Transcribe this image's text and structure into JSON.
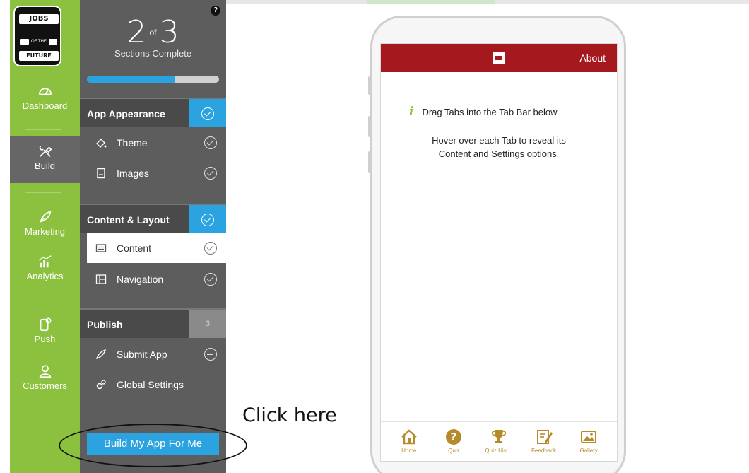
{
  "brand": {
    "logo_top": "JOBS",
    "logo_mid_small": "OF THE",
    "logo_bottom": "FUTURE",
    "accent": "#8cc13f",
    "blue": "#2aa3e0",
    "red": "#a4181e"
  },
  "nav": {
    "items": [
      {
        "label": "Dashboard",
        "icon": "dashboard-gauge-icon"
      },
      {
        "label": "Build",
        "icon": "build-tools-icon"
      },
      {
        "label": "Marketing",
        "icon": "rocket-icon"
      },
      {
        "label": "Analytics",
        "icon": "analytics-chart-icon"
      },
      {
        "label": "Push",
        "icon": "push-phone-icon"
      },
      {
        "label": "Customers",
        "icon": "customers-user-icon"
      }
    ]
  },
  "progress": {
    "completed": "2",
    "of": "of",
    "total": "3",
    "label": "Sections Complete",
    "fraction": 0.67
  },
  "sections": [
    {
      "title": "App Appearance",
      "badge": "check",
      "items": [
        {
          "label": "Theme",
          "icon": "paint-bucket-icon",
          "status": "check"
        },
        {
          "label": "Images",
          "icon": "image-file-icon",
          "status": "check"
        }
      ]
    },
    {
      "title": "Content & Layout",
      "badge": "check",
      "items": [
        {
          "label": "Content",
          "icon": "content-list-icon",
          "status": "check"
        },
        {
          "label": "Navigation",
          "icon": "navigation-layout-icon",
          "status": "check"
        }
      ]
    },
    {
      "title": "Publish",
      "badge": "3",
      "items": [
        {
          "label": "Submit App",
          "icon": "rocket-icon",
          "status": "minus"
        },
        {
          "label": "Global Settings",
          "icon": "gears-icon",
          "status": ""
        }
      ]
    }
  ],
  "build_button": "Build My App For Me",
  "annotation": "Click here",
  "phone": {
    "header_link": "About",
    "info_text": "Drag Tabs into the Tab Bar below.",
    "hint_line1": "Hover over each Tab to reveal its",
    "hint_line2": "Content and Settings options.",
    "tabs": [
      {
        "label": "Home",
        "icon": "home-icon"
      },
      {
        "label": "Quiz",
        "icon": "question-icon"
      },
      {
        "label": "Quiz Hist...",
        "icon": "trophy-icon"
      },
      {
        "label": "Feedback",
        "icon": "feedback-pencil-icon"
      },
      {
        "label": "Gallery",
        "icon": "gallery-image-icon"
      }
    ]
  }
}
